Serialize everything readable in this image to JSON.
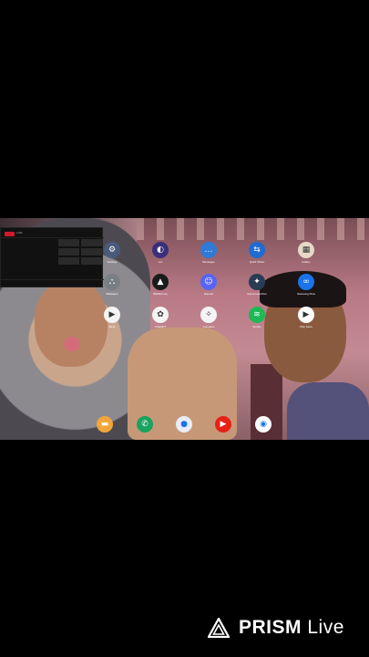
{
  "apps": [
    {
      "id": "settings",
      "icon": "gear-icon",
      "color": "#4a5a7a",
      "glyph": "⚙",
      "label": "Settings"
    },
    {
      "id": "opera",
      "icon": "opera-icon",
      "color": "#3b2f7a",
      "glyph": "◐",
      "label": "Arc"
    },
    {
      "id": "messages",
      "icon": "chat-icon",
      "color": "#2f7ad6",
      "glyph": "…",
      "label": "Messages"
    },
    {
      "id": "share",
      "icon": "share-icon",
      "color": "#1f6bd1",
      "glyph": "⇆",
      "label": "Quick Share"
    },
    {
      "id": "photos",
      "icon": "gallery-icon",
      "color": "#e6d9c7",
      "glyph": "▦",
      "label": "Gallery"
    },
    {
      "id": "avatar",
      "icon": "avatar-icon",
      "color": "#7a7f86",
      "glyph": "⛬",
      "label": "Wallpaper"
    },
    {
      "id": "chatgpt-dark",
      "icon": "triangle-icon",
      "color": "#1b1b1b",
      "glyph": "▲",
      "label": "PRISM Live"
    },
    {
      "id": "discord",
      "icon": "discord-icon",
      "color": "#5865f2",
      "glyph": "☺",
      "label": "Discord"
    },
    {
      "id": "games",
      "icon": "game-icon",
      "color": "#2a3b55",
      "glyph": "✦",
      "label": "Game Launcher"
    },
    {
      "id": "connect",
      "icon": "connect-icon",
      "color": "#1a73e8",
      "glyph": "∞",
      "label": "Samsung Flow"
    },
    {
      "id": "meet",
      "icon": "meet-icon",
      "color": "#f4f4f4",
      "glyph": "▶",
      "label": "Meet"
    },
    {
      "id": "chatgpt",
      "icon": "chatgpt-icon",
      "color": "#f4f4f4",
      "glyph": "✿",
      "label": "ChatGPT"
    },
    {
      "id": "compass",
      "icon": "compass-icon",
      "color": "#f4f4f4",
      "glyph": "✧",
      "label": "Compass"
    },
    {
      "id": "spotify",
      "icon": "spotify-icon",
      "color": "#1db954",
      "glyph": "≋",
      "label": "Spotify"
    },
    {
      "id": "play",
      "icon": "play-store-icon",
      "color": "#ffffff",
      "glyph": "▶",
      "label": "Play Store"
    }
  ],
  "dock": [
    {
      "id": "files",
      "icon": "folder-icon",
      "color": "#f2a63a",
      "glyph": "▬"
    },
    {
      "id": "phone",
      "icon": "phone-icon",
      "color": "#1aa260",
      "glyph": "✆"
    },
    {
      "id": "chat",
      "icon": "chat-bubble-icon",
      "color": "#e8edf7",
      "glyph": "●"
    },
    {
      "id": "youtube",
      "icon": "youtube-icon",
      "color": "#e62117",
      "glyph": "▶"
    },
    {
      "id": "chrome",
      "icon": "chrome-icon",
      "color": "#ffffff",
      "glyph": "◉"
    }
  ],
  "panel": {
    "rec_label": "LIVE"
  },
  "watermark": {
    "brand": "PRISM",
    "product": "Live"
  }
}
